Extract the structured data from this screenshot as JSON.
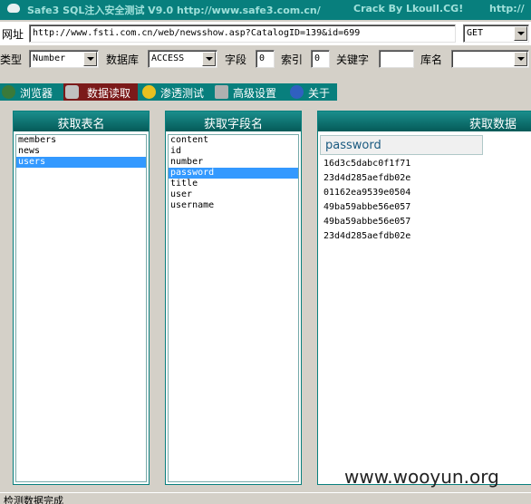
{
  "window": {
    "title": "Safe3 SQL注入安全测试 V9.0 http://www.safe3.com.cn/",
    "crack": "Crack  By  Lkoull.CG!",
    "title_tail": "http://"
  },
  "url_row": {
    "label": "网址",
    "value": "http://www.fsti.com.cn/web/newsshow.asp?CatalogID=139&id=699",
    "method": "GET"
  },
  "options_row": {
    "type_label": "类型",
    "type_value": "Number",
    "db_label": "数据库",
    "db_value": "ACCESS",
    "field_label": "字段",
    "field_value": "0",
    "index_label": "索引",
    "index_value": "0",
    "keyword_label": "关键字",
    "keyword_value": "",
    "dbname_label": "库名",
    "dbname_value": ""
  },
  "tabs": [
    {
      "label": "浏览器",
      "icon": "globe-icon"
    },
    {
      "label": "数据读取",
      "icon": "database-icon"
    },
    {
      "label": "渗透测试",
      "icon": "radiation-icon"
    },
    {
      "label": "高级设置",
      "icon": "tools-icon"
    },
    {
      "label": "关于",
      "icon": "info-icon"
    }
  ],
  "tables_panel": {
    "title": "获取表名",
    "items": [
      "members",
      "news",
      "users"
    ],
    "selected": "users"
  },
  "fields_panel": {
    "title": "获取字段名",
    "items": [
      "content",
      "id",
      "number",
      "password",
      "title",
      "user",
      "username"
    ],
    "selected": "password"
  },
  "data_panel": {
    "title": "获取数据",
    "column": "password",
    "rows": [
      "16d3c5dabc0f1f71",
      "23d4d285aefdb02e",
      "01162ea9539e0504",
      "49ba59abbe56e057",
      "49ba59abbe56e057",
      "23d4d285aefdb02e"
    ]
  },
  "watermark": "www.wooyun.org",
  "status_text": "检测数据完成",
  "colors": {
    "teal": "#087f7d",
    "active_tab": "#7b1a1a",
    "selection": "#3399ff"
  }
}
